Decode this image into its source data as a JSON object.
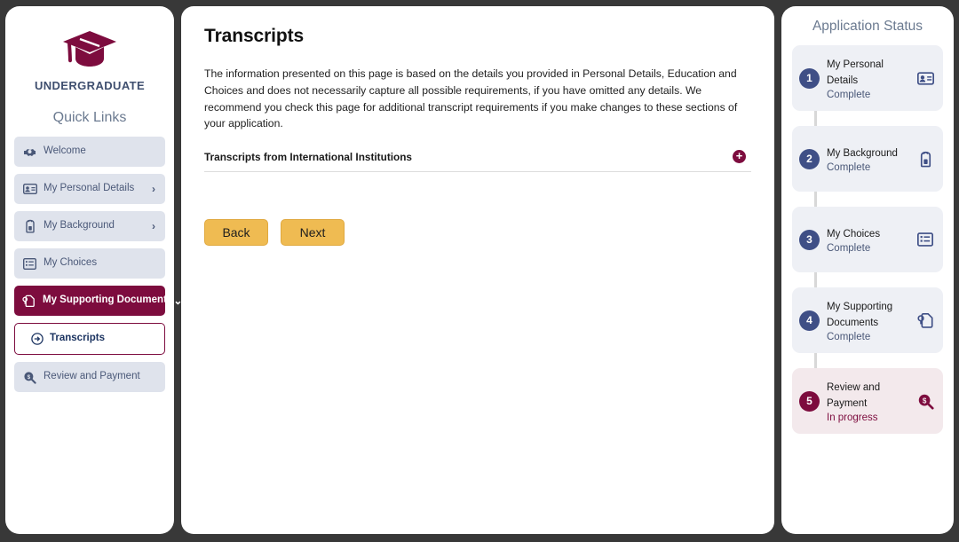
{
  "sidebar": {
    "logo_icon": "graduation-cap-icon",
    "brand": "UNDERGRADUATE",
    "quick_links_title": "Quick Links",
    "items": [
      {
        "label": "Welcome",
        "icon": "handshake-icon",
        "chevron": "",
        "state": "default"
      },
      {
        "label": "My Personal Details",
        "icon": "id-card-icon",
        "chevron": "›",
        "state": "default"
      },
      {
        "label": "My Background",
        "icon": "backpack-icon",
        "chevron": "›",
        "state": "default"
      },
      {
        "label": "My Choices",
        "icon": "list-icon",
        "chevron": "",
        "state": "default"
      },
      {
        "label": "My Supporting Documents",
        "icon": "document-badge-icon",
        "chevron": "⌄",
        "state": "active"
      },
      {
        "label": "Transcripts",
        "icon": "circle-arrow-icon",
        "chevron": "",
        "state": "subactive"
      },
      {
        "label": "Review and Payment",
        "icon": "search-dollar-icon",
        "chevron": "",
        "state": "default"
      }
    ]
  },
  "main": {
    "title": "Transcripts",
    "intro": "The information presented on this page is based on the details you provided in Personal Details, Education and Choices and does not necessarily capture all possible requirements, if you have omitted any details. We recommend you check this page for additional transcript requirements if you make changes to these sections of your application.",
    "section_title": "Transcripts from International Institutions",
    "expand_icon": "plus-circle-icon",
    "back_label": "Back",
    "next_label": "Next"
  },
  "status": {
    "title": "Application Status",
    "steps": [
      {
        "num": "1",
        "label": "My Personal Details",
        "status": "Complete",
        "icon": "id-card-icon",
        "state": "complete"
      },
      {
        "num": "2",
        "label": "My Background",
        "status": "Complete",
        "icon": "backpack-icon",
        "state": "complete"
      },
      {
        "num": "3",
        "label": "My Choices",
        "status": "Complete",
        "icon": "list-icon",
        "state": "complete"
      },
      {
        "num": "4",
        "label": "My Supporting Documents",
        "status": "Complete",
        "icon": "document-badge-icon",
        "state": "complete"
      },
      {
        "num": "5",
        "label": "Review and Payment",
        "status": "In progress",
        "icon": "search-dollar-icon",
        "state": "current"
      }
    ]
  },
  "colors": {
    "brand_maroon": "#7d0c3e",
    "navy": "#3f4f86",
    "accent_gold": "#efbb52",
    "page_bg": "#383838",
    "nav_bg": "#dfe3ec",
    "step_bg": "#eef0f5",
    "step_current_bg": "#f3e9ec"
  }
}
